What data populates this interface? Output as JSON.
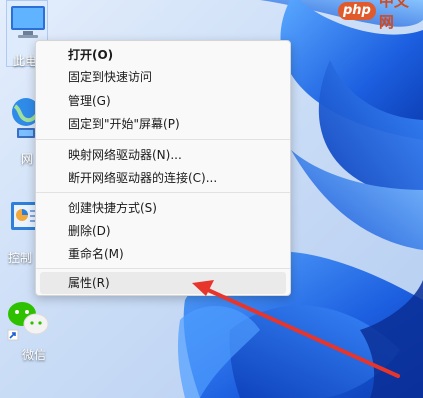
{
  "watermark": {
    "logo_text": "php",
    "site_text": "中文网"
  },
  "desktop": {
    "icons": [
      {
        "label": "此电",
        "icon": "computer-icon"
      },
      {
        "label": "网",
        "icon": "network-globe-icon"
      },
      {
        "label": "控制",
        "icon": "control-panel-icon"
      },
      {
        "label": "微信",
        "icon": "wechat-icon"
      }
    ]
  },
  "context_menu": {
    "items": [
      {
        "label": "打开(O)",
        "bold": true
      },
      {
        "label": "固定到快速访问"
      },
      {
        "label": "管理(G)"
      },
      {
        "label": "固定到\"开始\"屏幕(P)"
      },
      {
        "label": "映射网络驱动器(N)..."
      },
      {
        "label": "断开网络驱动器的连接(C)..."
      },
      {
        "label": "创建快捷方式(S)"
      },
      {
        "label": "删除(D)"
      },
      {
        "label": "重命名(M)"
      },
      {
        "label": "属性(R)"
      }
    ]
  },
  "colors": {
    "wallpaper_light": "#d7e6fa",
    "wallpaper_blue": "#1f63e0",
    "arrow": "#e8352b"
  }
}
